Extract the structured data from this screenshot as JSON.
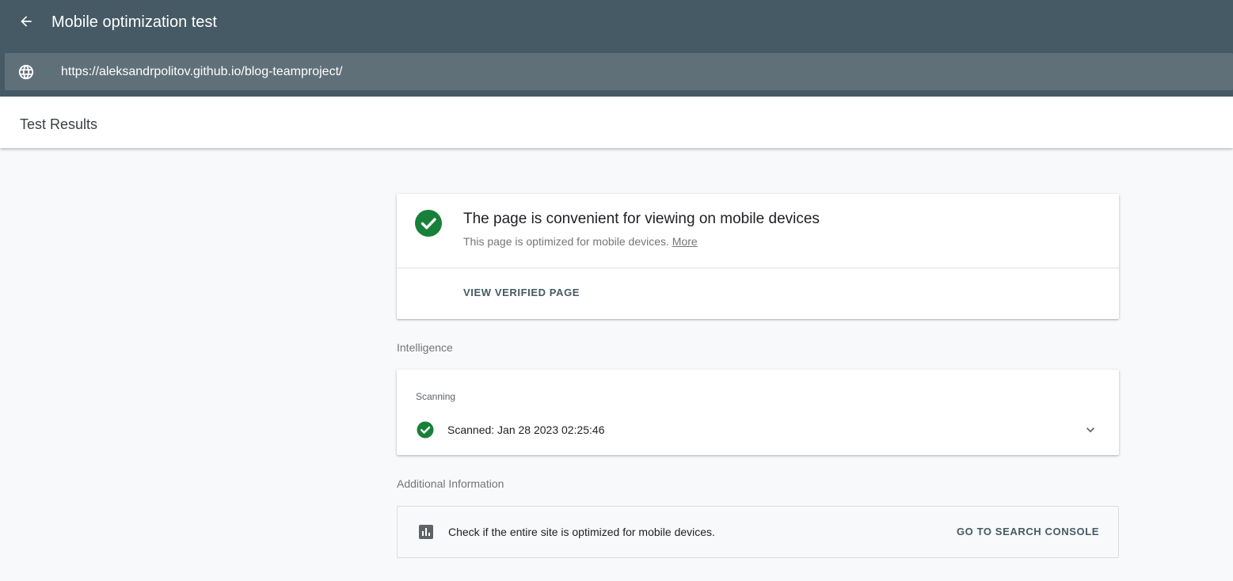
{
  "header": {
    "title": "Mobile optimization test",
    "url": "https://aleksandrpolitov.github.io/blog-teamproject/"
  },
  "subheader": {
    "title": "Test Results"
  },
  "result": {
    "title": "The page is convenient for viewing on mobile devices",
    "description": "This page is optimized for mobile devices.",
    "more_link": "More",
    "view_button": "VIEW VERIFIED PAGE",
    "status_color": "#188038"
  },
  "intelligence": {
    "section_label": "Intelligence",
    "heading": "Scanning",
    "scan_status": "Scanned: Jan 28 2023 02:25:46"
  },
  "additional": {
    "section_label": "Additional Information",
    "text": "Check if the entire site is optimized for mobile devices.",
    "button": "GO TO SEARCH CONSOLE"
  },
  "icons": {
    "back": "arrow-back-icon",
    "globe": "globe-icon",
    "check": "check-circle-icon",
    "chevron": "chevron-down-icon",
    "chart": "bar-chart-icon"
  },
  "colors": {
    "topbar": "#455a64",
    "urlbar": "#5f7079",
    "background": "#f8f9fa",
    "success": "#188038"
  }
}
